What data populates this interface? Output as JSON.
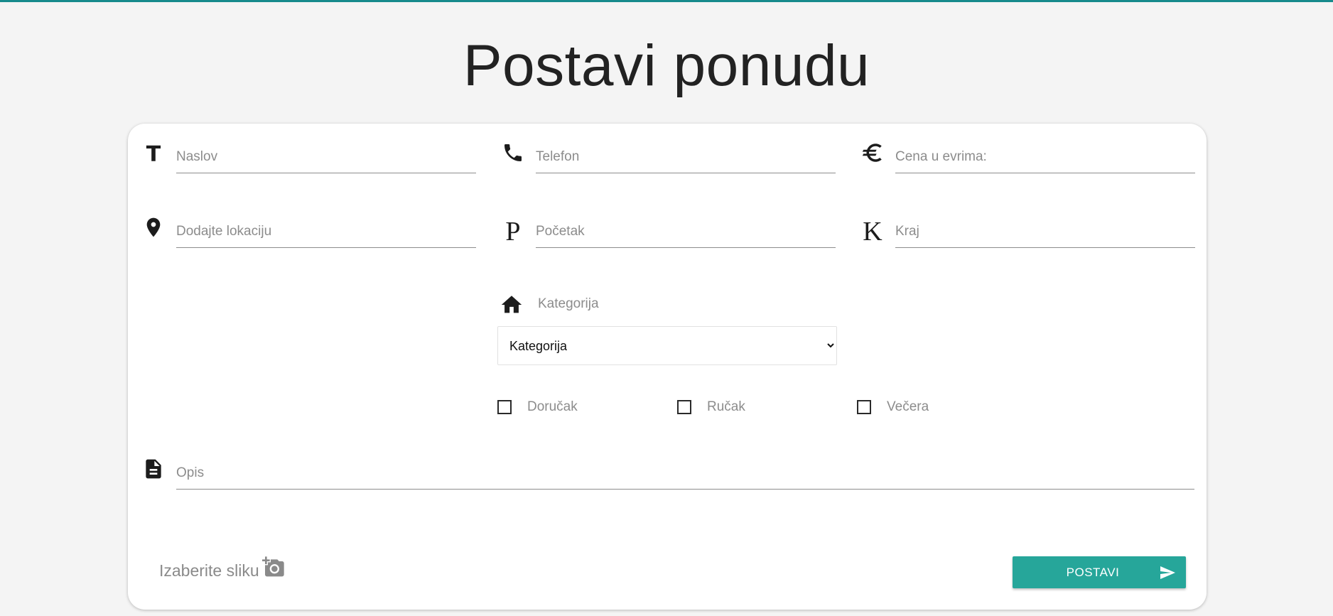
{
  "page": {
    "title": "Postavi ponudu",
    "accent_color": "#168a8c",
    "button_color": "#26a69a",
    "background_color": "#f4f4f4"
  },
  "fields": {
    "naslov": {
      "placeholder": "Naslov",
      "icon": "title-letter-t-icon",
      "glyph": "T"
    },
    "telefon": {
      "placeholder": "Telefon",
      "icon": "phone-icon"
    },
    "cena": {
      "placeholder": "Cena u evrima:",
      "icon": "euro-icon"
    },
    "lokacija": {
      "placeholder": "Dodajte lokaciju",
      "icon": "location-pin-icon"
    },
    "pocetak": {
      "placeholder": "Početak",
      "icon": "letter-p-icon",
      "glyph": "P"
    },
    "kraj": {
      "placeholder": "Kraj",
      "icon": "letter-k-icon",
      "glyph": "K"
    },
    "opis": {
      "placeholder": "Opis",
      "icon": "document-icon"
    }
  },
  "category": {
    "label": "Kategorija",
    "icon": "home-icon",
    "selected": "Kategorija"
  },
  "meals": [
    {
      "label": "Doručak",
      "checked": false
    },
    {
      "label": "Ručak",
      "checked": false
    },
    {
      "label": "Večera",
      "checked": false
    }
  ],
  "upload": {
    "label": "Izaberite sliku",
    "icon": "add-photo-icon"
  },
  "submit": {
    "label": "POSTAVI",
    "icon": "send-icon"
  }
}
